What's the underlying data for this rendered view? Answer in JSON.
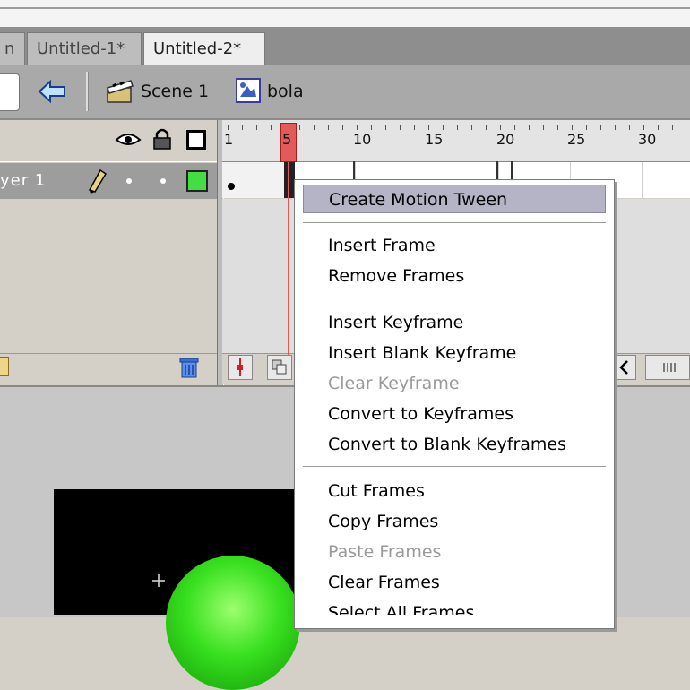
{
  "tabs": [
    {
      "label": "n"
    },
    {
      "label": "Untitled-1*"
    },
    {
      "label": "Untitled-2*"
    }
  ],
  "editbar": {
    "scene_label": "Scene 1",
    "symbol_label": "bola"
  },
  "timeline": {
    "layer_name": "yer 1",
    "frame_numbers": [
      "1",
      "5",
      "10",
      "15",
      "20",
      "25",
      "30"
    ],
    "current_frame": 5
  },
  "context_menu": {
    "items": [
      {
        "label": "Create Motion Tween",
        "enabled": true,
        "highlighted": true
      },
      {
        "label": "Insert Frame",
        "enabled": true
      },
      {
        "label": "Remove Frames",
        "enabled": true
      },
      {
        "label": "Insert Keyframe",
        "enabled": true
      },
      {
        "label": "Insert Blank Keyframe",
        "enabled": true
      },
      {
        "label": "Clear Keyframe",
        "enabled": false
      },
      {
        "label": "Convert to Keyframes",
        "enabled": true
      },
      {
        "label": "Convert to Blank Keyframes",
        "enabled": true
      },
      {
        "label": "Cut Frames",
        "enabled": true
      },
      {
        "label": "Copy Frames",
        "enabled": true
      },
      {
        "label": "Paste Frames",
        "enabled": false
      },
      {
        "label": "Clear Frames",
        "enabled": true
      },
      {
        "label": "Select All Frames",
        "enabled": true
      }
    ]
  },
  "colors": {
    "playhead": "#e35a5a",
    "menu_highlight": "#b5b3c6",
    "ball": "#38e01f",
    "layer_outline": "#44dd44"
  }
}
